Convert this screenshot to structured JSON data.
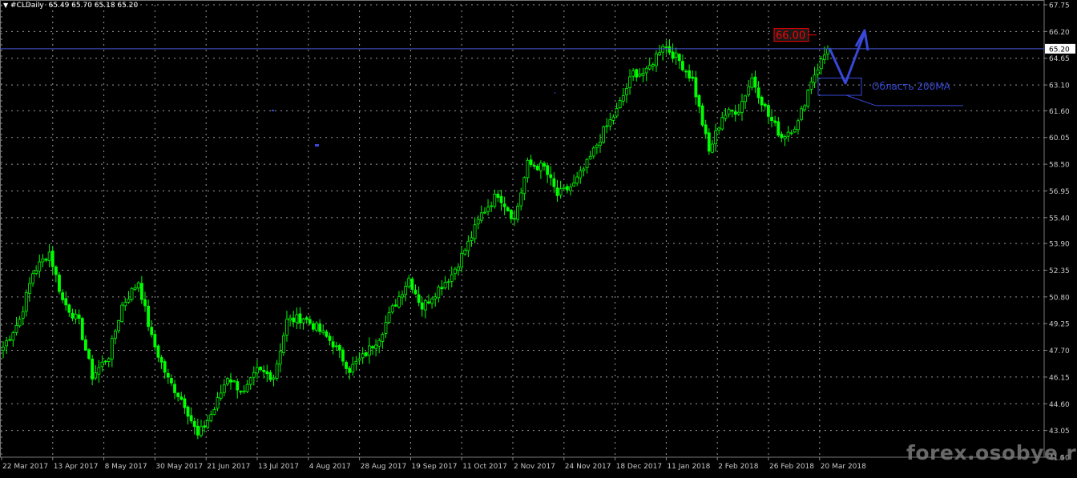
{
  "header": {
    "symbol": "#CLDaily",
    "ohlc": "65.49 65.70 65.18 65.20"
  },
  "colors": {
    "background": "#000000",
    "grid": "#9a9a9a",
    "candle_up": "#00ff00",
    "candle_down": "#00ff00",
    "candle_fill": "#000000",
    "axis_text": "#c8c8c8",
    "bid_line": "#4a57d6",
    "annotation_blue": "#3848d8",
    "price_tag_red": "#ff0000",
    "price_tag_bg": "#1a1a1a",
    "watermark": "#7a7a7a"
  },
  "annotations": {
    "price_tag": "66.00",
    "area_label": "Область 200MA",
    "current_price": "65.20"
  },
  "watermark": "forex.osobye.ru",
  "chart_data": {
    "type": "candlestick",
    "title": "",
    "y_axis_ticks": [
      "67.75",
      "66.20",
      "64.65",
      "63.10",
      "61.60",
      "60.05",
      "58.50",
      "56.95",
      "55.40",
      "53.90",
      "52.35",
      "50.80",
      "49.25",
      "47.70",
      "46.15",
      "44.60",
      "43.05",
      "41.50"
    ],
    "ylim": [
      41.5,
      67.75
    ],
    "x_axis_ticks": [
      "22 Mar 2017",
      "13 Apr 2017",
      "8 May 2017",
      "30 May 2017",
      "21 Jun 2017",
      "13 Jul 2017",
      "4 Aug 2017",
      "28 Aug 2017",
      "19 Sep 2017",
      "11 Oct 2017",
      "2 Nov 2017",
      "24 Nov 2017",
      "18 Dec 2017",
      "11 Jan 2018",
      "2 Feb 2018",
      "26 Feb 2018",
      "20 Mar 2018"
    ],
    "bid_price": 65.2,
    "close_anchors": [
      {
        "date": "22 Mar 2017",
        "close": 47.9
      },
      {
        "date": "29 Mar 2017",
        "close": 49.5
      },
      {
        "date": "6 Apr 2017",
        "close": 52.2
      },
      {
        "date": "12 Apr 2017",
        "close": 53.4
      },
      {
        "date": "20 Apr 2017",
        "close": 50.6
      },
      {
        "date": "28 Apr 2017",
        "close": 49.3
      },
      {
        "date": "5 May 2017",
        "close": 46.2
      },
      {
        "date": "10 May 2017",
        "close": 47.4
      },
      {
        "date": "19 May 2017",
        "close": 50.3
      },
      {
        "date": "25 May 2017",
        "close": 51.7
      },
      {
        "date": "1 Jun 2017",
        "close": 48.4
      },
      {
        "date": "9 Jun 2017",
        "close": 46.0
      },
      {
        "date": "15 Jun 2017",
        "close": 44.6
      },
      {
        "date": "21 Jun 2017",
        "close": 42.7
      },
      {
        "date": "27 Jun 2017",
        "close": 44.3
      },
      {
        "date": "3 Jul 2017",
        "close": 46.2
      },
      {
        "date": "11 Jul 2017",
        "close": 45.2
      },
      {
        "date": "18 Jul 2017",
        "close": 46.5
      },
      {
        "date": "24 Jul 2017",
        "close": 46.2
      },
      {
        "date": "28 Jul 2017",
        "close": 49.4
      },
      {
        "date": "3 Aug 2017",
        "close": 49.6
      },
      {
        "date": "10 Aug 2017",
        "close": 49.0
      },
      {
        "date": "18 Aug 2017",
        "close": 48.1
      },
      {
        "date": "28 Aug 2017",
        "close": 46.6
      },
      {
        "date": "1 Sep 2017",
        "close": 47.3
      },
      {
        "date": "12 Sep 2017",
        "close": 48.5
      },
      {
        "date": "19 Sep 2017",
        "close": 50.1
      },
      {
        "date": "26 Sep 2017",
        "close": 51.9
      },
      {
        "date": "3 Oct 2017",
        "close": 50.2
      },
      {
        "date": "11 Oct 2017",
        "close": 51.3
      },
      {
        "date": "18 Oct 2017",
        "close": 52.1
      },
      {
        "date": "27 Oct 2017",
        "close": 53.9
      },
      {
        "date": "3 Nov 2017",
        "close": 55.6
      },
      {
        "date": "10 Nov 2017",
        "close": 56.8
      },
      {
        "date": "16 Nov 2017",
        "close": 55.3
      },
      {
        "date": "24 Nov 2017",
        "close": 58.5
      },
      {
        "date": "1 Dec 2017",
        "close": 58.3
      },
      {
        "date": "7 Dec 2017",
        "close": 56.7
      },
      {
        "date": "15 Dec 2017",
        "close": 57.3
      },
      {
        "date": "22 Dec 2017",
        "close": 58.5
      },
      {
        "date": "29 Dec 2017",
        "close": 60.4
      },
      {
        "date": "5 Jan 2018",
        "close": 61.6
      },
      {
        "date": "11 Jan 2018",
        "close": 63.8
      },
      {
        "date": "17 Jan 2018",
        "close": 63.8
      },
      {
        "date": "24 Jan 2018",
        "close": 65.5
      },
      {
        "date": "30 Jan 2018",
        "close": 64.5
      },
      {
        "date": "5 Feb 2018",
        "close": 63.4
      },
      {
        "date": "9 Feb 2018",
        "close": 59.2
      },
      {
        "date": "15 Feb 2018",
        "close": 61.3
      },
      {
        "date": "21 Feb 2018",
        "close": 61.7
      },
      {
        "date": "26 Feb 2018",
        "close": 63.5
      },
      {
        "date": "2 Mar 2018",
        "close": 61.3
      },
      {
        "date": "8 Mar 2018",
        "close": 60.1
      },
      {
        "date": "14 Mar 2018",
        "close": 60.9
      },
      {
        "date": "20 Mar 2018",
        "close": 63.4
      },
      {
        "date": "23 Mar 2018",
        "close": 65.2
      }
    ]
  }
}
